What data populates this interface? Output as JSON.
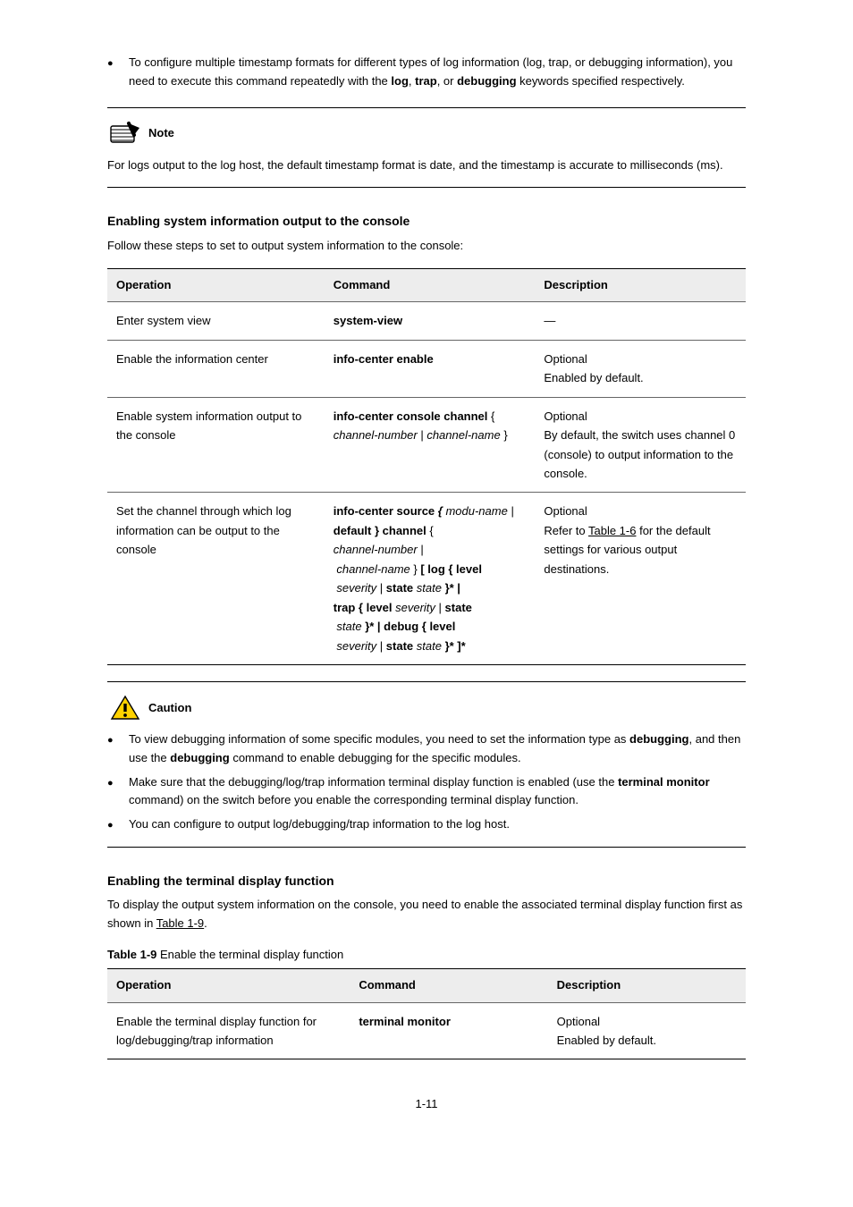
{
  "top_bullet": {
    "pre": "To configure multiple timestamp formats for different types of log information (log, trap, or debugging information), you need to execute this command repeatedly with the ",
    "bold1": "log",
    "mid1": ", ",
    "bold2": "trap",
    "mid2": ", or ",
    "bold3": "debugging",
    "post": " keywords specified respectively."
  },
  "note": {
    "label": "Note",
    "body": "For logs output to the log host, the default timestamp format is date, and the timestamp is accurate to milliseconds (ms)."
  },
  "section1": {
    "heading": "Enabling system information output to the console",
    "para": "Follow these steps to set to output system information to the console:",
    "table_caption": "",
    "headers": [
      "Operation",
      "Command",
      "Description"
    ],
    "rows": [
      {
        "op": "Enter system view",
        "cmd": "system-view",
        "desc": "—"
      },
      {
        "op": "Enable the information center",
        "cmd": "info-center enable",
        "desc_line1": "Optional",
        "desc_line2": "Enabled by default."
      },
      {
        "op": "Enable system information output to the console",
        "cmd": {
          "pre": "info-center console channel ",
          "arg_i": "channel-number",
          "mid": " | ",
          "arg_i2": "channel-name",
          "post": " }"
        },
        "desc_line1": "Optional",
        "desc_line2": "By default, the switch uses channel 0 (console) to output information to the console."
      },
      {
        "op": "Set the channel through which log information can be output to the console",
        "cmd": {
          "line1_bold": "info-center source ",
          "line1_i": "{ modu-name",
          "line1_rest": " |",
          "line2_bold": "default } channel ",
          "line2_rest": "{",
          "line3_i": "channel-number ",
          "line3_rest": "|",
          "line4_i": " channel-name ",
          "line4_b": "} [ log { level",
          "line5_i": " severity ",
          "line5_b": "| state ",
          "line5_i2": "state",
          "line5_b2": " }* |",
          "line6_b": "trap { level ",
          "line6_i": "severity ",
          "line6_b2": "| state",
          "line7_i": " state ",
          "line7_b": "}* | debug { level",
          "line8_i": " severity ",
          "line8_b": "| state ",
          "line8_i2": "state",
          "line8_b2": " }* ]*"
        },
        "desc_line1": "Optional",
        "desc_pre": "Refer to ",
        "desc_link": "Table 1-6",
        "desc_post": " for the default settings for various output destinations."
      }
    ]
  },
  "caution": {
    "label": "Caution",
    "bullets": [
      {
        "pre": "To view debugging information of some specific modules, you need to set the information type as ",
        "b1": "debugging",
        "mid": ", and then use the ",
        "b2": "debugging",
        "post": " command to enable debugging for the specific modules."
      },
      {
        "pre": "Make sure that the debugging/log/trap information terminal display function is enabled (use the ",
        "b1": "terminal monitor",
        "post": " command) on the switch before you enable the corresponding terminal display function."
      },
      {
        "pre": "You can configure to output log/debugging/trap information to the log host.",
        "b1": "",
        "post": ""
      }
    ]
  },
  "section2": {
    "heading": "Enabling the terminal display function",
    "para_pre": "To display the output system information on the console, you need to enable the associated terminal display function first as shown in ",
    "para_link": "Table 1-9",
    "para_post": ".",
    "table_caption": "Table 1-9 ",
    "table_caption_rest": "Enable the terminal display function",
    "headers": [
      "Operation",
      "Command",
      "Description"
    ],
    "rows": [
      {
        "op": "Enable the terminal display function for log/debugging/trap information",
        "cmd": "terminal monitor",
        "desc_line1": "Optional",
        "desc_line2": "Enabled by default."
      }
    ]
  },
  "page_number": "1-11"
}
